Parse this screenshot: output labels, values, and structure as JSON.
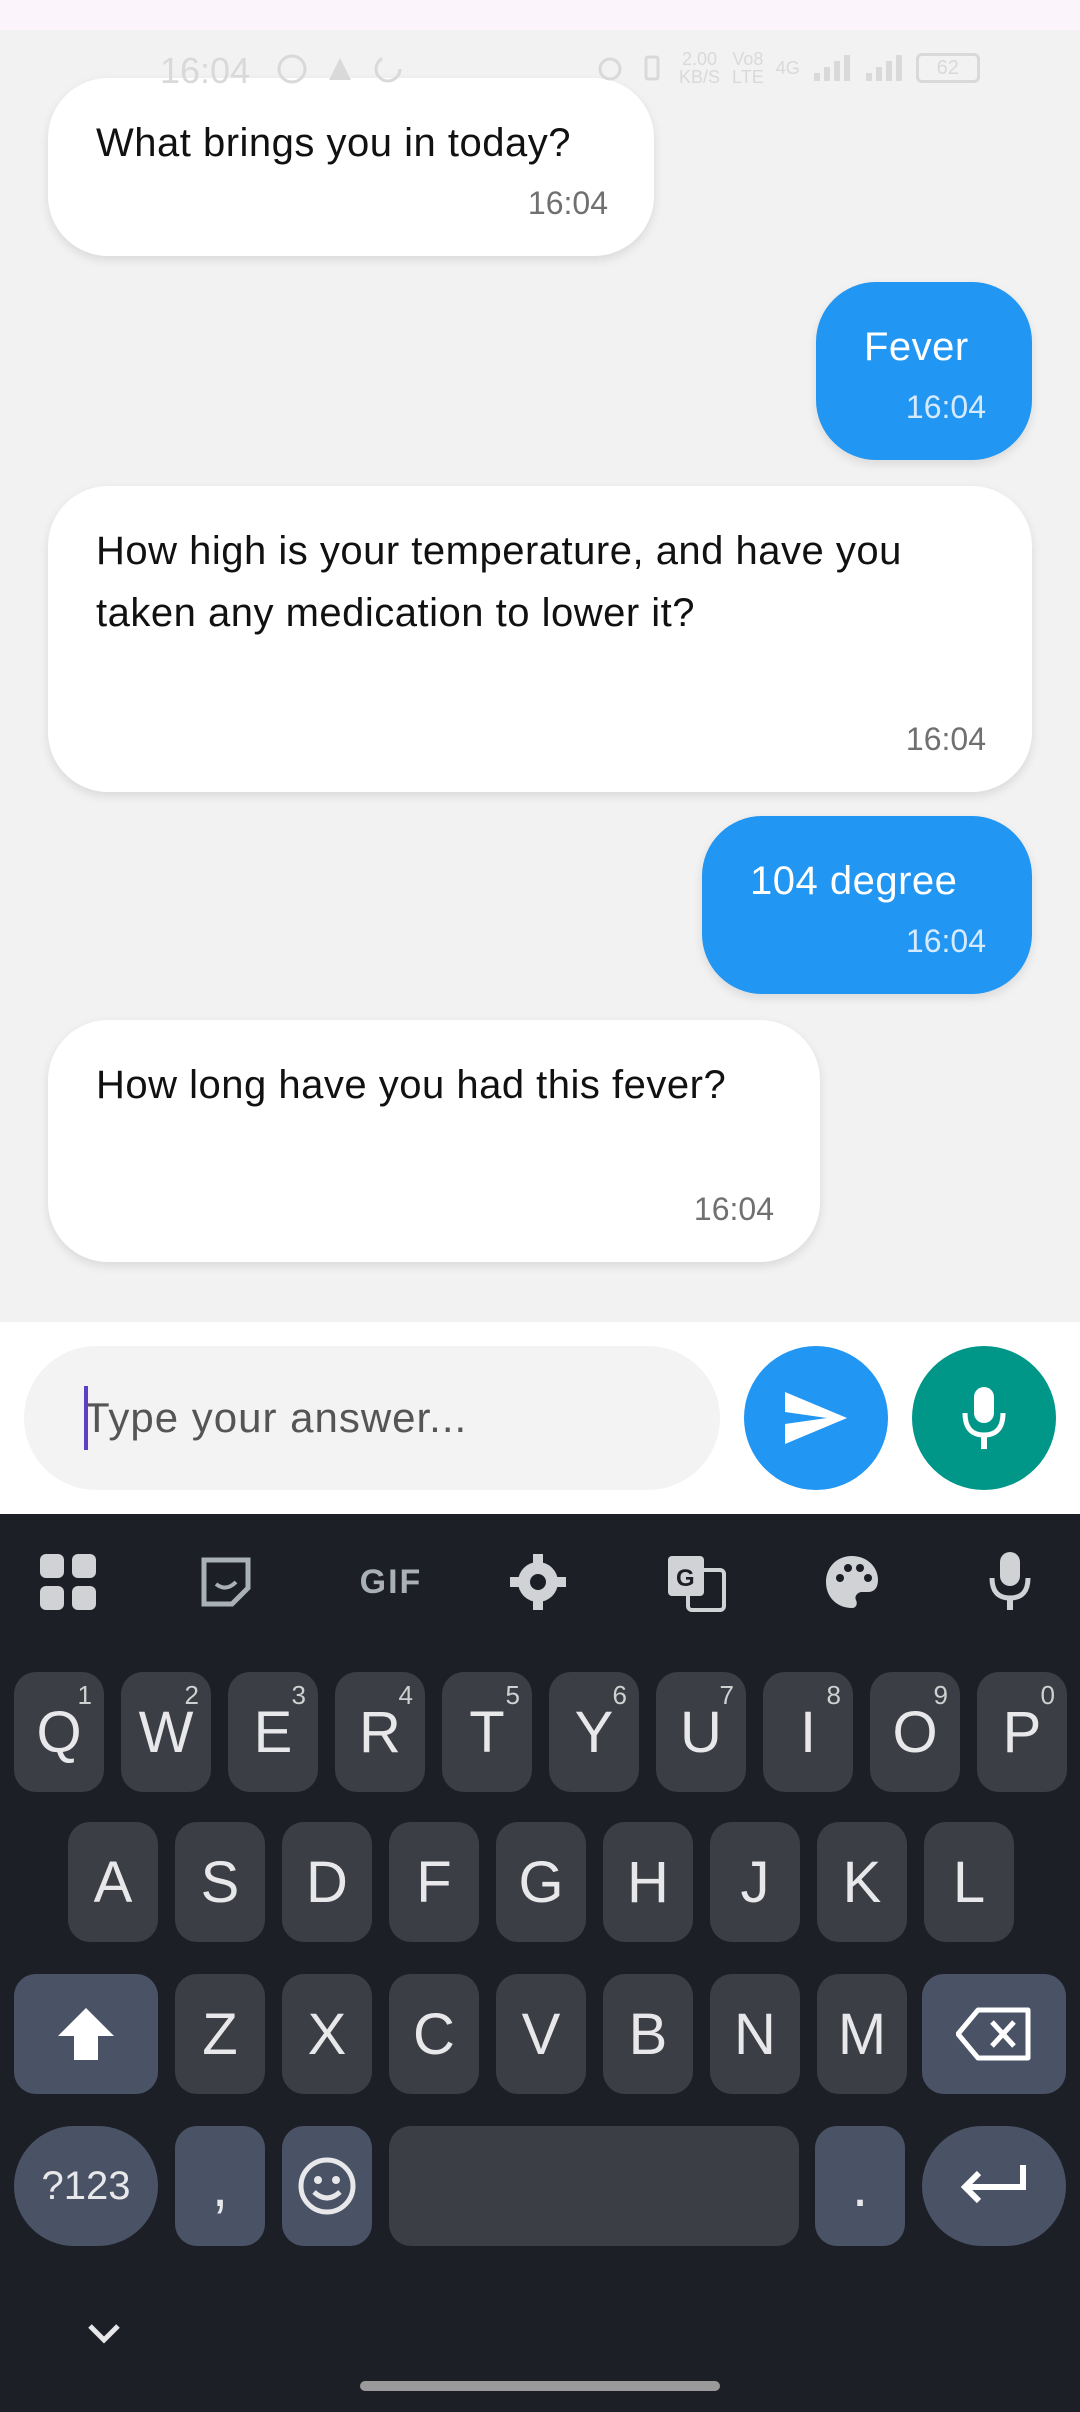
{
  "status_bar": {
    "time": "16:04",
    "net_speed": "2.00\nKB/S",
    "volte": "Vo8\nLTE",
    "network": "4G",
    "battery": "62"
  },
  "messages": [
    {
      "sender": "bot",
      "text": "What brings you in today?",
      "time": "16:04"
    },
    {
      "sender": "user",
      "text": "Fever",
      "time": "16:04"
    },
    {
      "sender": "bot",
      "text": "How high is your temperature, and have you taken any medication to lower it?",
      "time": "16:04"
    },
    {
      "sender": "user",
      "text": "104 degree",
      "time": "16:04"
    },
    {
      "sender": "bot",
      "text": "How long have you had this fever?",
      "time": "16:04"
    }
  ],
  "input": {
    "placeholder": "Type your answer...",
    "value": ""
  },
  "keyboard": {
    "toolbar": [
      "apps-grid-icon",
      "sticker-icon",
      "GIF",
      "settings-gear-icon",
      "translate-icon",
      "palette-icon",
      "mic-icon"
    ],
    "row1": [
      {
        "key": "Q",
        "hint": "1"
      },
      {
        "key": "W",
        "hint": "2"
      },
      {
        "key": "E",
        "hint": "3"
      },
      {
        "key": "R",
        "hint": "4"
      },
      {
        "key": "T",
        "hint": "5"
      },
      {
        "key": "Y",
        "hint": "6"
      },
      {
        "key": "U",
        "hint": "7"
      },
      {
        "key": "I",
        "hint": "8"
      },
      {
        "key": "O",
        "hint": "9"
      },
      {
        "key": "P",
        "hint": "0"
      }
    ],
    "row2": [
      "A",
      "S",
      "D",
      "F",
      "G",
      "H",
      "J",
      "K",
      "L"
    ],
    "row3": [
      "Z",
      "X",
      "C",
      "V",
      "B",
      "N",
      "M"
    ],
    "row4": {
      "symbols": "?123",
      "comma": ",",
      "period": "."
    }
  },
  "colors": {
    "user_bubble": "#2196f3",
    "send_button": "#2196f3",
    "mic_button": "#009688",
    "keyboard_bg": "#1c1f26"
  }
}
